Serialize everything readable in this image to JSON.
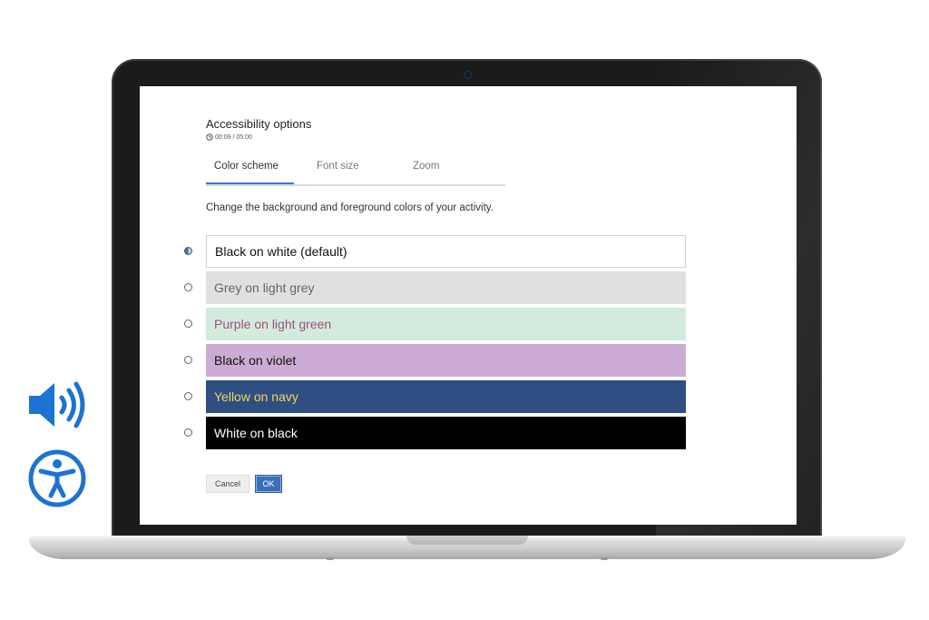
{
  "dialog": {
    "title": "Accessibility options",
    "timer": "00:09 / 05:00"
  },
  "tabs": [
    {
      "label": "Color scheme",
      "active": true
    },
    {
      "label": "Font size",
      "active": false
    },
    {
      "label": "Zoom",
      "active": false
    }
  ],
  "description": "Change the background and foreground colors of your activity.",
  "options": [
    {
      "label": "Black on white (default)",
      "selected": true,
      "bg": "#ffffff",
      "fg": "#111111",
      "border": "#d0d0d0"
    },
    {
      "label": "Grey on light grey",
      "selected": false,
      "bg": "#e0e0e0",
      "fg": "#666666"
    },
    {
      "label": "Purple on light green",
      "selected": false,
      "bg": "#d3ebdc",
      "fg": "#9b4f80"
    },
    {
      "label": "Black on violet",
      "selected": false,
      "bg": "#ccacd4",
      "fg": "#111111"
    },
    {
      "label": "Yellow on navy",
      "selected": false,
      "bg": "#2f4f83",
      "fg": "#f2d65a"
    },
    {
      "label": "White on black",
      "selected": false,
      "bg": "#000000",
      "fg": "#ffffff"
    }
  ],
  "buttons": {
    "cancel": "Cancel",
    "ok": "OK"
  },
  "colors": {
    "accent": "#3c6fb8",
    "icon_blue": "#1d73d1"
  },
  "side_icons": [
    "speaker-icon",
    "accessibility-icon"
  ]
}
